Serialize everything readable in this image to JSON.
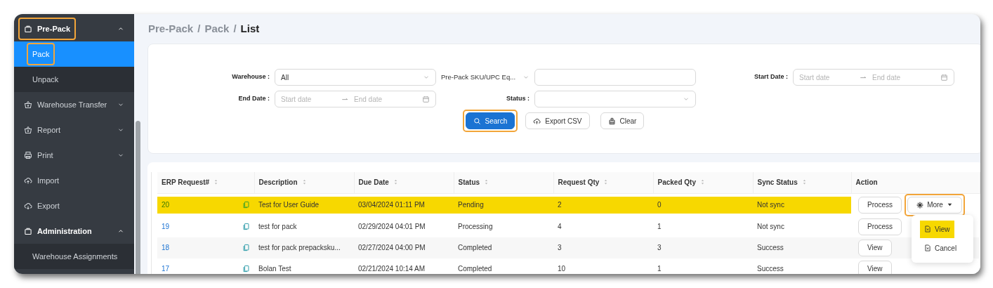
{
  "sidebar": {
    "items": [
      {
        "kind": "group",
        "label": "Pre-Pack",
        "expanded": true,
        "annotated": true,
        "children": [
          {
            "label": "Pack",
            "selected": true,
            "annotated": true
          },
          {
            "label": "Unpack",
            "selected": false,
            "annotated": false
          }
        ]
      },
      {
        "kind": "group",
        "label": "Warehouse Transfer",
        "expanded": false,
        "annotated": false
      },
      {
        "kind": "group",
        "label": "Report",
        "expanded": false,
        "annotated": false
      },
      {
        "kind": "group",
        "label": "Print",
        "expanded": false,
        "annotated": false
      },
      {
        "kind": "link",
        "label": "Import",
        "annotated": false
      },
      {
        "kind": "link",
        "label": "Export",
        "annotated": false
      },
      {
        "kind": "group",
        "label": "Administration",
        "expanded": true,
        "annotated": false,
        "children": [
          {
            "label": "Warehouse Assignments",
            "selected": false,
            "annotated": false
          }
        ]
      }
    ]
  },
  "breadcrumb": {
    "separator": "/",
    "items": [
      "Pre-Pack",
      "Pack",
      "List"
    ]
  },
  "filters": {
    "warehouse": {
      "label": "Warehouse :",
      "value": "All"
    },
    "sku_mode": {
      "value": "Pre-Pack SKU/UPC Eq..."
    },
    "start_date": {
      "label": "Start Date :",
      "from_placeholder": "Start date",
      "to_placeholder": "End date"
    },
    "end_date": {
      "label": "End Date :",
      "from_placeholder": "Start date",
      "to_placeholder": "End date"
    },
    "status": {
      "label": "Status :"
    },
    "buttons": [
      {
        "kind": "primary",
        "label": "Search",
        "annotated": true
      },
      {
        "kind": "export",
        "label": "Export CSV",
        "annotated": false
      },
      {
        "kind": "clear",
        "label": "Clear",
        "annotated": false
      }
    ]
  },
  "table": {
    "columns": [
      {
        "label": "ERP Request#",
        "sortable": true
      },
      {
        "label": "Description",
        "sortable": true
      },
      {
        "label": "Due Date",
        "sortable": true
      },
      {
        "label": "Status",
        "sortable": true
      },
      {
        "label": "Request Qty",
        "sortable": true
      },
      {
        "label": "Packed Qty",
        "sortable": true
      },
      {
        "label": "Sync Status",
        "sortable": true
      },
      {
        "label": "Action",
        "sortable": false
      }
    ],
    "rows": [
      {
        "erp": "20",
        "description": "Test for User Guide",
        "due_date": "03/04/2024 01:11 PM",
        "status": "Pending",
        "request_qty": "2",
        "packed_qty": "0",
        "sync_status": "Not sync",
        "highlighted": true,
        "actions": [
          {
            "kind": "plain",
            "label": "Process"
          },
          {
            "kind": "more",
            "label": "More",
            "annotated": true,
            "menu": [
              {
                "label": "View",
                "highlighted": true
              },
              {
                "label": "Cancel",
                "highlighted": false
              }
            ]
          }
        ]
      },
      {
        "erp": "19",
        "description": "test for pack",
        "due_date": "02/29/2024 04:01 PM",
        "status": "Processing",
        "request_qty": "4",
        "packed_qty": "1",
        "sync_status": "Not sync",
        "highlighted": false,
        "actions": [
          {
            "kind": "plain",
            "label": "Process"
          }
        ]
      },
      {
        "erp": "18",
        "description": "test for pack prepacksku...",
        "due_date": "02/27/2024 04:00 PM",
        "status": "Completed",
        "request_qty": "3",
        "packed_qty": "3",
        "sync_status": "Success",
        "highlighted": false,
        "actions": [
          {
            "kind": "plain",
            "label": "View"
          }
        ]
      },
      {
        "erp": "17",
        "description": "Bolan Test",
        "due_date": "02/21/2024 10:14 AM",
        "status": "Completed",
        "request_qty": "10",
        "packed_qty": "1",
        "sync_status": "Success",
        "highlighted": false,
        "actions": [
          {
            "kind": "plain",
            "label": "View"
          }
        ]
      }
    ]
  }
}
